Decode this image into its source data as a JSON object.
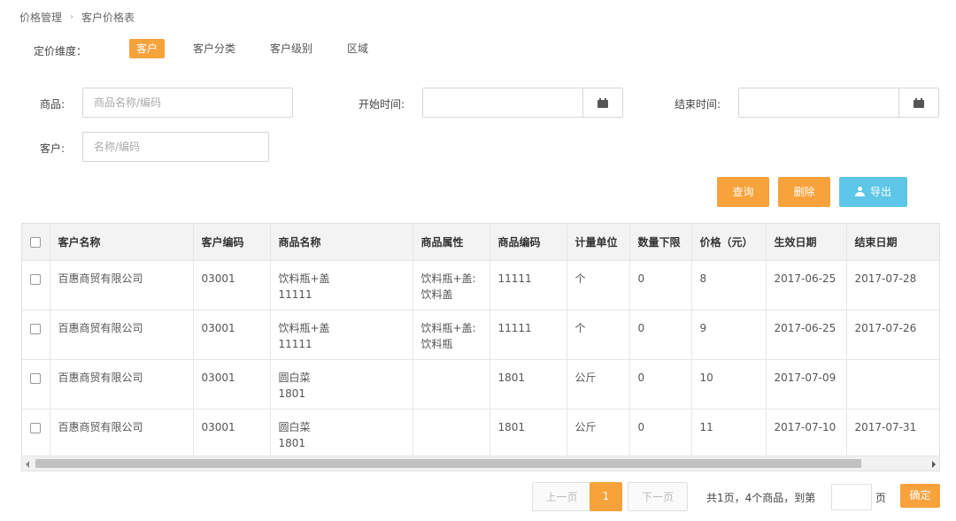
{
  "breadcrumb": {
    "root": "价格管理",
    "current": "客户价格表"
  },
  "dimension": {
    "label": "定价维度：",
    "tabs": [
      "客户",
      "客户分类",
      "客户级别",
      "区域"
    ],
    "active_tab": "客户"
  },
  "filters": {
    "product_label": "商品:",
    "product_placeholder": "商品名称/编码",
    "start_label": "开始时间:",
    "end_label": "结束时间:",
    "customer_label": "客户:",
    "customer_placeholder": "名称/编码"
  },
  "actions": {
    "query": "查询",
    "delete": "删除",
    "export": "导出"
  },
  "table": {
    "columns": [
      "客户名称",
      "客户编码",
      "商品名称",
      "商品属性",
      "商品编码",
      "计量单位",
      "数量下限",
      "价格（元）",
      "生效日期",
      "结束日期"
    ],
    "rows": [
      {
        "customer": "百惠商贸有限公司",
        "code": "03001",
        "product_line1": "饮料瓶+盖",
        "product_line2": "11111",
        "attr_line1": "饮料瓶+盖:",
        "attr_line2": "饮料盖",
        "product_code": "11111",
        "unit": "个",
        "min_qty": "0",
        "price": "8",
        "start": "2017-06-25",
        "end": "2017-07-28"
      },
      {
        "customer": "百惠商贸有限公司",
        "code": "03001",
        "product_line1": "饮料瓶+盖",
        "product_line2": "11111",
        "attr_line1": "饮料瓶+盖:",
        "attr_line2": "饮料瓶",
        "product_code": "11111",
        "unit": "个",
        "min_qty": "0",
        "price": "9",
        "start": "2017-06-25",
        "end": "2017-07-26"
      },
      {
        "customer": "百惠商贸有限公司",
        "code": "03001",
        "product_line1": "圆白菜",
        "product_line2": "1801",
        "attr_line1": "",
        "attr_line2": "",
        "product_code": "1801",
        "unit": "公斤",
        "min_qty": "0",
        "price": "10",
        "start": "2017-07-09",
        "end": ""
      },
      {
        "customer": "百惠商贸有限公司",
        "code": "03001",
        "product_line1": "圆白菜",
        "product_line2": "1801",
        "attr_line1": "",
        "attr_line2": "",
        "product_code": "1801",
        "unit": "公斤",
        "min_qty": "0",
        "price": "11",
        "start": "2017-07-10",
        "end": "2017-07-31"
      }
    ]
  },
  "pagination": {
    "prev": "上一页",
    "current": "1",
    "next": "下一页",
    "info": "共1页，4个商品，到第",
    "unit": "页",
    "confirm": "确定"
  },
  "colors": {
    "accent": "#f7a23b",
    "export": "#5ec6e6"
  }
}
